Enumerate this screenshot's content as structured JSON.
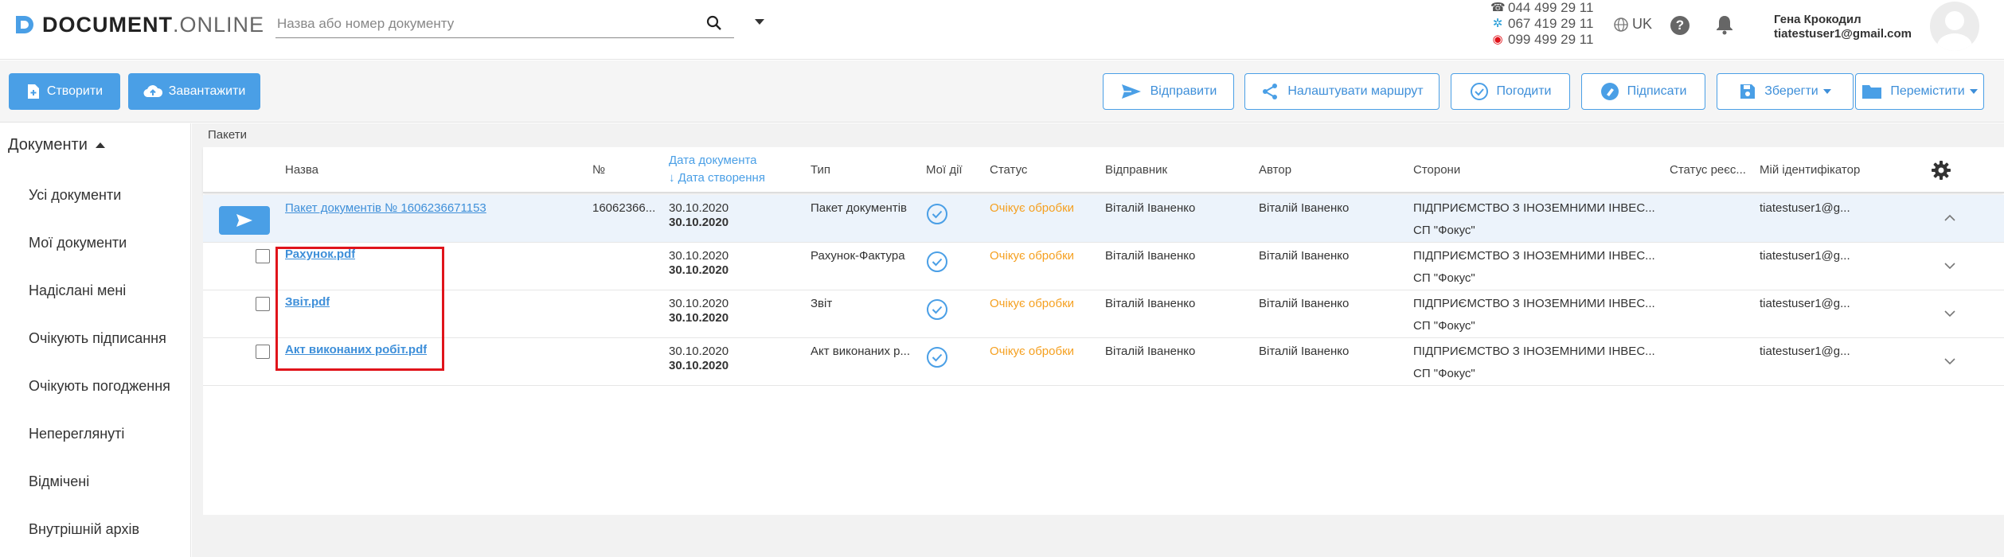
{
  "app": {
    "logo_bold": "DOCUMENT",
    "logo_light": ".ONLINE"
  },
  "search": {
    "placeholder": "Назва або номер документу"
  },
  "contacts": {
    "phone1": "044 499 29 11",
    "phone2": "067 419 29 11",
    "phone3": "099 499 29 11"
  },
  "header": {
    "language": "UK",
    "help": "?",
    "user_name": "Гена Крокодил",
    "user_email": "tiatestuser1@gmail.com"
  },
  "toolbar": {
    "create": "Створити",
    "upload": "Завантажити",
    "send": "Відправити",
    "route": "Налаштувати маршрут",
    "approve": "Погодити",
    "sign": "Підписати",
    "save": "Зберегти",
    "move": "Перемістити"
  },
  "sidebar": {
    "section": "Документи",
    "items": [
      "Усі документи",
      "Мої документи",
      "Надіслані мені",
      "Очікують підписання",
      "Очікують погодження",
      "Непереглянуті",
      "Відмічені",
      "Внутрішній архів"
    ]
  },
  "content": {
    "breadcrumb": "Пакети"
  },
  "table": {
    "headers": {
      "name": "Назва",
      "number": "№",
      "doc_date": "Дата документа",
      "created_date": "↓ Дата створення",
      "type": "Тип",
      "my_actions": "Мої дії",
      "status": "Статус",
      "sender": "Відправник",
      "author": "Автор",
      "parties": "Сторони",
      "registry_status": "Статус реєс...",
      "my_id": "Мій ідентифікатор"
    },
    "package": {
      "name": "Пакет документів № 1606236671153",
      "number": "16062366...",
      "doc_date": "30.10.2020",
      "created_date": "30.10.2020",
      "type": "Пакет документів",
      "status": "Очікує обробки",
      "sender": "Віталій Іваненко",
      "author": "Віталій Іваненко",
      "party1": "ПІДПРИЄМСТВО З ІНОЗЕМНИМИ ІНВЕС...",
      "party2": "СП \"Фокус\"",
      "my_id": "tiatestuser1@g..."
    },
    "rows": [
      {
        "name": "Рахунок.pdf",
        "doc_date": "30.10.2020",
        "created_date": "30.10.2020",
        "type": "Рахунок-Фактура",
        "status": "Очікує обробки",
        "sender": "Віталій Іваненко",
        "author": "Віталій Іваненко",
        "party1": "ПІДПРИЄМСТВО З ІНОЗЕМНИМИ ІНВЕС...",
        "party2": "СП \"Фокус\"",
        "my_id": "tiatestuser1@g..."
      },
      {
        "name": "Звіт.pdf",
        "doc_date": "30.10.2020",
        "created_date": "30.10.2020",
        "type": "Звіт",
        "status": "Очікує обробки",
        "sender": "Віталій Іваненко",
        "author": "Віталій Іваненко",
        "party1": "ПІДПРИЄМСТВО З ІНОЗЕМНИМИ ІНВЕС...",
        "party2": "СП \"Фокус\"",
        "my_id": "tiatestuser1@g..."
      },
      {
        "name": "Акт виконаних робіт.pdf",
        "doc_date": "30.10.2020",
        "created_date": "30.10.2020",
        "type": "Акт виконаних р...",
        "status": "Очікує обробки",
        "sender": "Віталій Іваненко",
        "author": "Віталій Іваненко",
        "party1": "ПІДПРИЄМСТВО З ІНОЗЕМНИМИ ІНВЕС...",
        "party2": "СП \"Фокус\"",
        "my_id": "tiatestuser1@g..."
      }
    ]
  },
  "colors": {
    "accent": "#4a9fe6",
    "status_pending": "#f5a020",
    "highlight": "#e0141b"
  }
}
